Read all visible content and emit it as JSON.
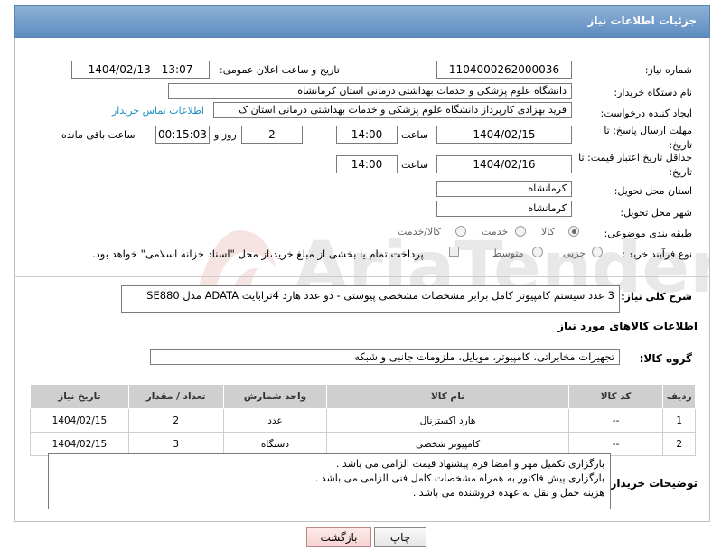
{
  "header": {
    "title": "جزئیات اطلاعات نیاز"
  },
  "need_number": {
    "label": "شماره نیاز:",
    "value": "1104000262000036"
  },
  "announce": {
    "label": "تاریخ و ساعت اعلان عمومی:",
    "value": "1404/02/13 - 13:07"
  },
  "buyer_org": {
    "label": "نام دستگاه خریدار:",
    "value": "دانشگاه علوم پزشکی و خدمات بهداشتی  درمانی استان کرمانشاه"
  },
  "requester": {
    "label": "ایجاد کننده درخواست:",
    "value": "فرید  بهزادی کارپرداز دانشگاه علوم پزشکی و خدمات بهداشتی  درمانی استان ک",
    "contact_link": "اطلاعات تماس خریدار"
  },
  "reply_deadline": {
    "label": "مهلت ارسال پاسخ: تا تاریخ:",
    "date": "1404/02/15",
    "time_label": "ساعت",
    "time": "14:00",
    "days": "2",
    "days_label": "روز و",
    "remaining": "00:15:03",
    "remaining_label": "ساعت باقی مانده"
  },
  "price_validity": {
    "label": "حداقل تاریخ اعتبار قیمت: تا تاریخ:",
    "date": "1404/02/16",
    "time_label": "ساعت",
    "time": "14:00"
  },
  "province": {
    "label": "استان محل تحویل:",
    "value": "کرمانشاه"
  },
  "city": {
    "label": "شهر محل تحویل:",
    "value": "کرمانشاه"
  },
  "category": {
    "label": "طبقه بندی موضوعی:",
    "options": [
      "کالا",
      "خدمت",
      "کالا/خدمت"
    ],
    "selected": "کالا"
  },
  "process": {
    "label": "نوع فرآیند خرید :",
    "options": [
      "جزیی",
      "متوسط"
    ],
    "payment_note": "پرداخت تمام یا بخشی از مبلغ خرید،از محل \"اسناد خزانه اسلامی\" خواهد بود."
  },
  "description": {
    "label": "شرح کلی نیاز:",
    "value": "3 عدد سیستم کامپیوتر کامل برابر مشخصات مشخصی پیوستی - دو عدد هارد 4ترابایت ADATA مدل SE880"
  },
  "goods_info": {
    "title": "اطلاعات کالاهای مورد نیاز"
  },
  "goods_group": {
    "label": "گروه کالا:",
    "value": "تجهیزات مخابراتی، کامپیوتر، موبایل، ملزومات جانبی و شبکه"
  },
  "table": {
    "headers": [
      "ردیف",
      "کد کالا",
      "نام کالا",
      "واحد شمارش",
      "تعداد / مقدار",
      "تاریخ نیاز"
    ],
    "rows": [
      [
        "1",
        "--",
        "هارد اکسترنال",
        "عدد",
        "2",
        "1404/02/15"
      ],
      [
        "2",
        "--",
        "کامپیوتر شخصی",
        "دستگاه",
        "3",
        "1404/02/15"
      ]
    ]
  },
  "buyer_notes": {
    "label": "توضیحات خریدار:",
    "lines": [
      "بارگزاری تکمیل مهر و امضا فرم پیشنهاد قیمت الزامی می باشد .",
      "بارگزاری پیش فاکتور به همراه مشخصات کامل فنی الزامی می باشد .",
      "هزینه حمل و نقل به عهده فروشنده می باشد ."
    ]
  },
  "buttons": {
    "print": "چاپ",
    "back": "بازگشت"
  }
}
